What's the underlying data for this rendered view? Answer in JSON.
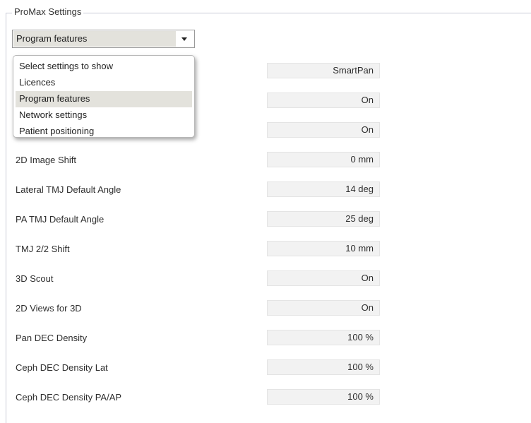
{
  "group_title": "ProMax Settings",
  "category_combo": {
    "value": "Program features",
    "options": [
      "Select settings to show",
      "Licences",
      "Program features",
      "Network settings",
      "Patient positioning"
    ]
  },
  "hidden_rows": [
    {
      "value": "SmartPan"
    },
    {
      "value": "On"
    },
    {
      "value": "On"
    }
  ],
  "rows": [
    {
      "label": "2D Image Shift",
      "value": "0 mm"
    },
    {
      "label": "Lateral TMJ Default Angle",
      "value": "14 deg"
    },
    {
      "label": "PA TMJ Default Angle",
      "value": "25 deg"
    },
    {
      "label": "TMJ 2/2 Shift",
      "value": "10 mm"
    },
    {
      "label": "3D Scout",
      "value": "On"
    },
    {
      "label": "2D Views for 3D",
      "value": "On"
    },
    {
      "label": "Pan DEC Density",
      "value": "100 %"
    },
    {
      "label": "Ceph DEC Density Lat",
      "value": "100 %"
    },
    {
      "label": "Ceph DEC Density PA/AP",
      "value": "100 %"
    }
  ]
}
